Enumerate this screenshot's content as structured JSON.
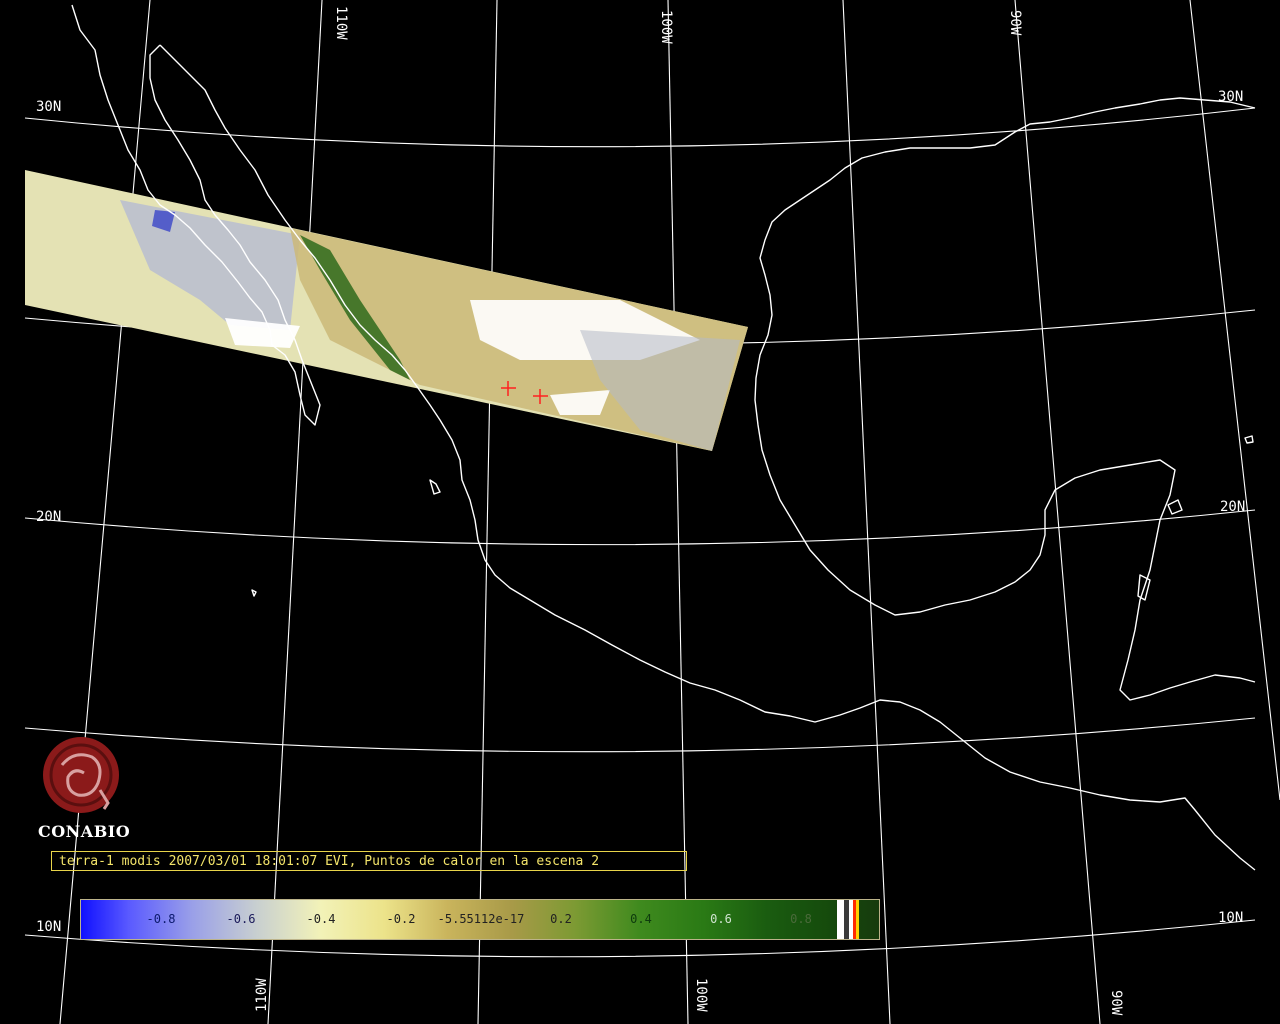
{
  "map": {
    "latitude_labels": [
      "30N",
      "30N",
      "20N",
      "20N",
      "10N",
      "10N"
    ],
    "longitude_labels": [
      "110W",
      "100W",
      "90W",
      "110W",
      "100W",
      "90W"
    ],
    "hotspots_count": 2,
    "hotspot_color": "#ff2020",
    "coastline_color": "#ffffff",
    "grid_color": "#ffffff",
    "background_color": "#000000"
  },
  "logo": {
    "name": "CONABIO",
    "emblem_color": "#8b1a1a"
  },
  "caption": "terra-1 modis 2007/03/01 18:01:07 EVI, Puntos de calor en la escena 2",
  "colorbar": {
    "variable": "EVI",
    "range": [
      -1,
      1
    ],
    "ticks": [
      "-0.8",
      "-0.6",
      "-0.4",
      "-0.2",
      "-5.55112e-17",
      "0.2",
      "0.4",
      "0.6",
      "0.8"
    ],
    "tick_colors": [
      "#0c1a6e",
      "#1a1a5a",
      "#222222",
      "#222222",
      "#222222",
      "#222222",
      "#0d3b0d",
      "#cfe3cf",
      "#4a6a3a"
    ],
    "special_colors": [
      "#ffffff",
      "#3a3a3a",
      "#ffffff",
      "#ff2a00",
      "#ffd000"
    ]
  }
}
